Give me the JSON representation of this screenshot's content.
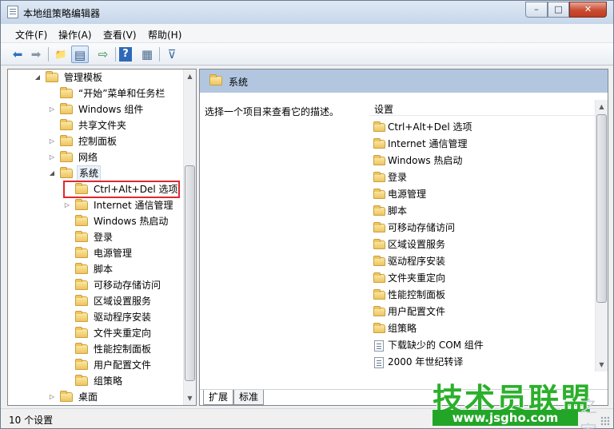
{
  "window": {
    "title": "本地组策略编辑器"
  },
  "controls": {
    "minimize": "–",
    "maximize": "□",
    "close": "✕"
  },
  "menu": [
    "文件(F)",
    "操作(A)",
    "查看(V)",
    "帮助(H)"
  ],
  "toolbar": {
    "icons": [
      "back-arrow-icon",
      "forward-arrow-icon",
      "up-folder-icon",
      "show-hide-tree-icon",
      "export-list-icon",
      "help-icon",
      "properties-view-icon",
      "filter-icon"
    ],
    "glyphs": [
      "⬅",
      "➡",
      "📁",
      "▤",
      "⇨",
      "?",
      "▦",
      "⊽"
    ]
  },
  "tree": {
    "rows": [
      {
        "label": "管理模板",
        "expand": "◢",
        "depth": 0
      },
      {
        "label": "“开始”菜单和任务栏",
        "expand": "",
        "depth": 1
      },
      {
        "label": "Windows 组件",
        "expand": "▷",
        "depth": 1
      },
      {
        "label": "共享文件夹",
        "expand": "",
        "depth": 1
      },
      {
        "label": "控制面板",
        "expand": "▷",
        "depth": 1
      },
      {
        "label": "网络",
        "expand": "▷",
        "depth": 1
      },
      {
        "label": "系统",
        "expand": "◢",
        "depth": 1
      },
      {
        "label": "Ctrl+Alt+Del 选项",
        "expand": "",
        "depth": 2
      },
      {
        "label": "Internet 通信管理",
        "expand": "▷",
        "depth": 2
      },
      {
        "label": "Windows 热启动",
        "expand": "",
        "depth": 2
      },
      {
        "label": "登录",
        "expand": "",
        "depth": 2
      },
      {
        "label": "电源管理",
        "expand": "",
        "depth": 2
      },
      {
        "label": "脚本",
        "expand": "",
        "depth": 2
      },
      {
        "label": "可移动存储访问",
        "expand": "",
        "depth": 2
      },
      {
        "label": "区域设置服务",
        "expand": "",
        "depth": 2
      },
      {
        "label": "驱动程序安装",
        "expand": "",
        "depth": 2
      },
      {
        "label": "文件夹重定向",
        "expand": "",
        "depth": 2
      },
      {
        "label": "性能控制面板",
        "expand": "",
        "depth": 2
      },
      {
        "label": "用户配置文件",
        "expand": "",
        "depth": 2
      },
      {
        "label": "组策略",
        "expand": "",
        "depth": 2
      },
      {
        "label": "桌面",
        "expand": "▷",
        "depth": 1
      }
    ]
  },
  "scroll": {
    "up": "▲",
    "down": "▼"
  },
  "details": {
    "header": "系统",
    "description": "选择一个项目来查看它的描述。",
    "column": "设置",
    "items": [
      {
        "label": "Ctrl+Alt+Del 选项",
        "kind": "folder"
      },
      {
        "label": "Internet 通信管理",
        "kind": "folder"
      },
      {
        "label": "Windows 热启动",
        "kind": "folder"
      },
      {
        "label": "登录",
        "kind": "folder"
      },
      {
        "label": "电源管理",
        "kind": "folder"
      },
      {
        "label": "脚本",
        "kind": "folder"
      },
      {
        "label": "可移动存储访问",
        "kind": "folder"
      },
      {
        "label": "区域设置服务",
        "kind": "folder"
      },
      {
        "label": "驱动程序安装",
        "kind": "folder"
      },
      {
        "label": "文件夹重定向",
        "kind": "folder"
      },
      {
        "label": "性能控制面板",
        "kind": "folder"
      },
      {
        "label": "用户配置文件",
        "kind": "folder"
      },
      {
        "label": "组策略",
        "kind": "folder"
      },
      {
        "label": "下载缺少的 COM 组件",
        "kind": "setting"
      },
      {
        "label": "2000 年世纪转译",
        "kind": "setting"
      }
    ],
    "tabs": [
      "扩展",
      "标准"
    ]
  },
  "status": {
    "text": "10 个设置"
  },
  "watermark": {
    "main": "技术员联盟",
    "sub": "www.jsgho.com",
    "tail": "之家"
  }
}
